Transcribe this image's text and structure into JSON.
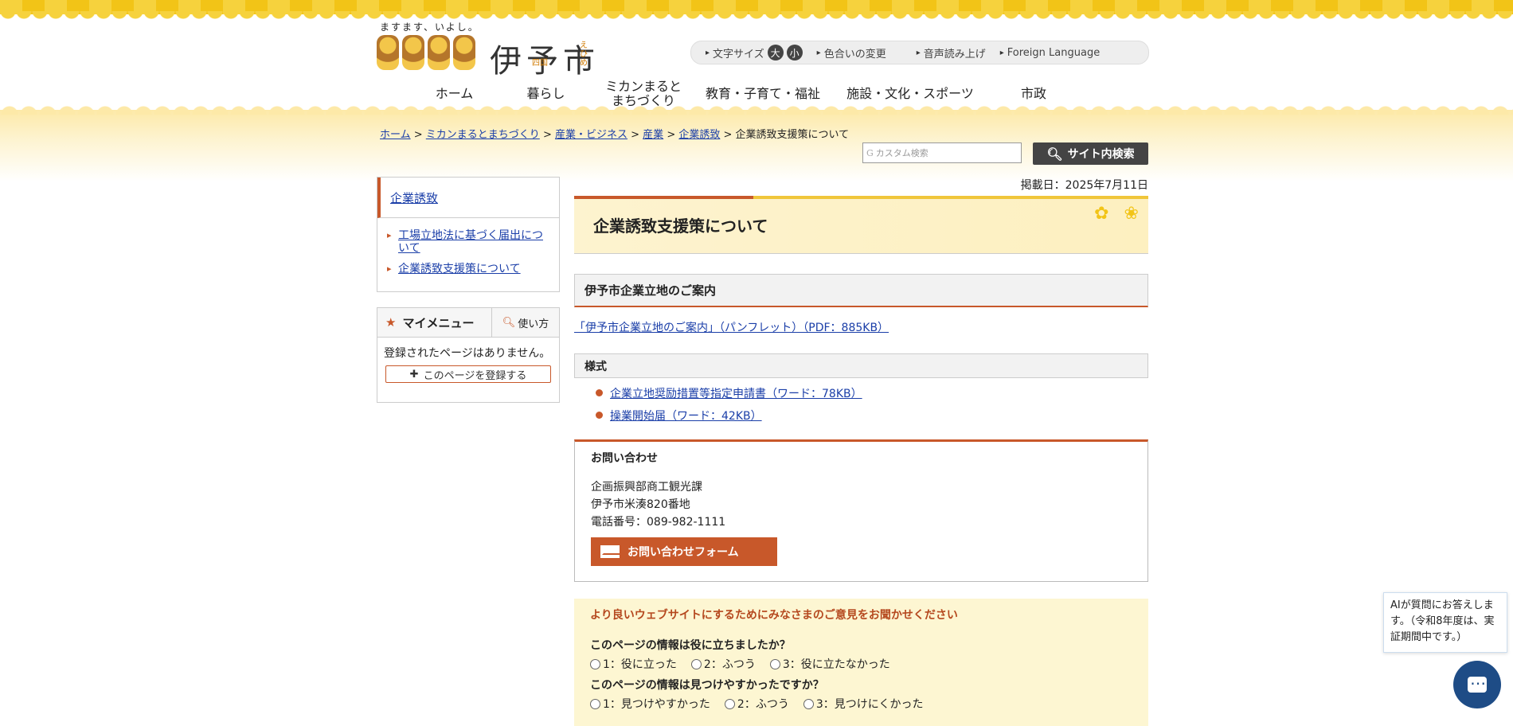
{
  "site": {
    "tagline": "ますます、いよし。",
    "logo_text": "伊予市",
    "logo_sub1": "四国",
    "logo_sub2": "えひめ"
  },
  "utility": {
    "font_size_label": "文字サイズ",
    "font_large": "大",
    "font_small": "小",
    "color_change": "色合いの変更",
    "read_aloud": "音声読み上げ",
    "foreign_language": "Foreign Language"
  },
  "nav": [
    "ホーム",
    "暮らし",
    "ミカンまるとまちづくり",
    "教育・子育て・福祉",
    "施設・文化・スポーツ",
    "市政"
  ],
  "breadcrumb": {
    "items": [
      "ホーム",
      "ミカンまるとまちづくり",
      "産業・ビジネス",
      "産業",
      "企業誘致"
    ],
    "current": "企業誘致支援策について"
  },
  "search": {
    "placeholder": "カスタム検索",
    "button": "サイト内検索"
  },
  "sidebar": {
    "heading": "企業誘致",
    "links": [
      "工場立地法に基づく届出について",
      "企業誘致支援策について"
    ]
  },
  "mymenu": {
    "title": "マイメニュー",
    "help": "使い方",
    "empty": "登録されたページはありません。",
    "add": "このページを登録する"
  },
  "page": {
    "post_date": "掲載日：2025年7月11日",
    "title": "企業誘致支援策について",
    "section1": "伊予市企業立地のご案内",
    "pdf_link": "「伊予市企業立地のご案内」（パンフレット）（PDF：885KB）",
    "section2": "様式",
    "docs": [
      "企業立地奨励措置等指定申請書（ワード：78KB）",
      "操業開始届（ワード：42KB）"
    ]
  },
  "contact": {
    "title": "お問い合わせ",
    "dept": "企画振興部商工観光課",
    "address": "伊予市米湊820番地",
    "phone": "電話番号：089-982-1111",
    "form_button": "お問い合わせフォーム"
  },
  "feedback": {
    "title": "より良いウェブサイトにするためにみなさまのご意見をお聞かせください",
    "q1": "このページの情報は役に立ちましたか？",
    "q1_options": [
      "1：役に立った",
      "2：ふつう",
      "3：役に立たなかった"
    ],
    "q2": "このページの情報は見つけやすかったですか？",
    "q2_options": [
      "1：見つけやすかった",
      "2：ふつう",
      "3：見つけにくかった"
    ]
  },
  "ai": {
    "bubble": "AIが質問にお答えします。（令和8年度は、実証期間中です。）"
  },
  "colors": {
    "accent": "#c8582a",
    "yellow": "#f2c417",
    "link": "#1a3ea8",
    "ai_button": "#1e4c86"
  }
}
